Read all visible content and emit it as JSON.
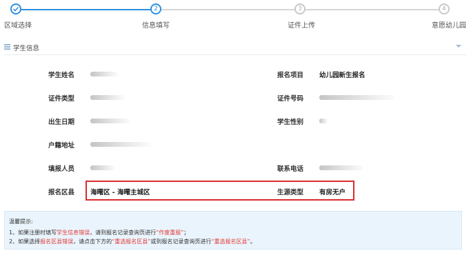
{
  "stepper": {
    "steps": [
      {
        "number": "",
        "label": "区域选择",
        "state": "done"
      },
      {
        "number": "2",
        "label": "信息填写",
        "state": "current"
      },
      {
        "number": "3",
        "label": "证件上传",
        "state": "todo"
      },
      {
        "number": "4",
        "label": "意愿幼儿园",
        "state": "todo"
      }
    ]
  },
  "section": {
    "title": "学生信息"
  },
  "fields": {
    "student_name": {
      "label": "学生姓名"
    },
    "enroll_project": {
      "label": "报名项目",
      "value": "幼儿园新生报名"
    },
    "id_type": {
      "label": "证件类型"
    },
    "id_number": {
      "label": "证件号码"
    },
    "birth_date": {
      "label": "出生日期"
    },
    "gender": {
      "label": "学生性别"
    },
    "household_address": {
      "label": "户籍地址"
    },
    "filler": {
      "label": "填报人员"
    },
    "phone": {
      "label": "联系电话"
    },
    "district": {
      "label": "报名区县",
      "value": "海曙区 - 海曙主城区"
    },
    "source_type": {
      "label": "生源类型",
      "value": "有房无户"
    }
  },
  "tips": {
    "title": "温馨提示:",
    "line1": {
      "prefix": "1、如果注册时填写",
      "highlight1": "学生信息错误",
      "middle": "，请到报名记录查询页进行",
      "highlight2": "“作废重报”",
      "suffix": "；"
    },
    "line2": {
      "prefix": "2、如果选择",
      "highlight1": "报名区县错误",
      "middle": "，请点击下方的",
      "highlight2": "“重选报名区县”",
      "middle2": "或到报名记录查询页进行",
      "highlight3": "“重选报名区县”",
      "suffix": "。"
    }
  },
  "colors": {
    "accent": "#2d8fe0",
    "inactive": "#c8c8c8",
    "alert_red": "#d92c2c",
    "tip_bg": "#eaf4fc"
  }
}
